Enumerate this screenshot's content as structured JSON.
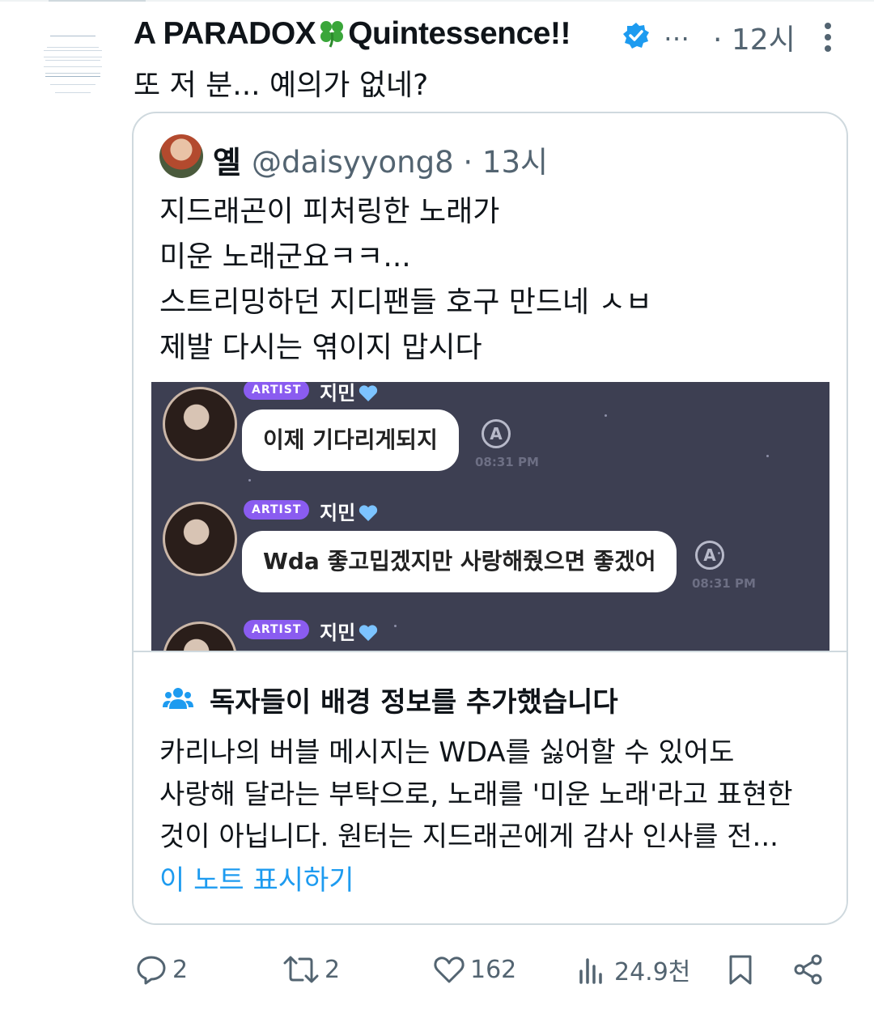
{
  "tweet": {
    "display_name": "A PARADOX",
    "display_name_suffix": "Quintessence!!",
    "ellipsis": "…",
    "time": "· 12시",
    "text": "또 저 분... 예의가 없네?"
  },
  "quote": {
    "name": "옐",
    "handle_time": "@daisyyong8 · 13시",
    "lines": [
      "지드래곤이 피처링한 노래가",
      "미운 노래군요ㅋㅋ...",
      "스트리밍하던 지디팬들 호구 만드네 ㅅㅂ",
      "제발 다시는 엮이지 맙시다"
    ]
  },
  "chat_image": {
    "messages": [
      {
        "tag": "ARTIST",
        "name": "지민",
        "bubble": "이제 기다리게되지",
        "time": "08:31 PM"
      },
      {
        "tag": "ARTIST",
        "name": "지민",
        "bubble": "Wda 좋고밉겠지만 사랑해줬으면 좋겠어",
        "time": "08:31 PM"
      },
      {
        "tag": "ARTIST",
        "name": "지민",
        "bubble": "",
        "time": ""
      }
    ],
    "a_label": "A"
  },
  "community_note": {
    "title": "독자들이 배경 정보를 추가했습니다",
    "lines": [
      "카리나의 버블 메시지는 WDA를 싫어할 수 있어도",
      "사랑해 달라는 부탁으로, 노래를 '미운 노래'라고 표현한",
      "것이 아닙니다. 원터는 지드래곤에게 감사 인사를 전..."
    ],
    "link": "이 노트 표시하기"
  },
  "actions": {
    "replies": "2",
    "retweets": "2",
    "likes": "162",
    "views": "24.9천"
  },
  "colors": {
    "accent": "#1d9bf0",
    "text": "#0f1419",
    "muted": "#536471",
    "border": "#cfd9de",
    "artist_tag": "#8a5cf0",
    "chat_bg": "#3d3f52"
  }
}
